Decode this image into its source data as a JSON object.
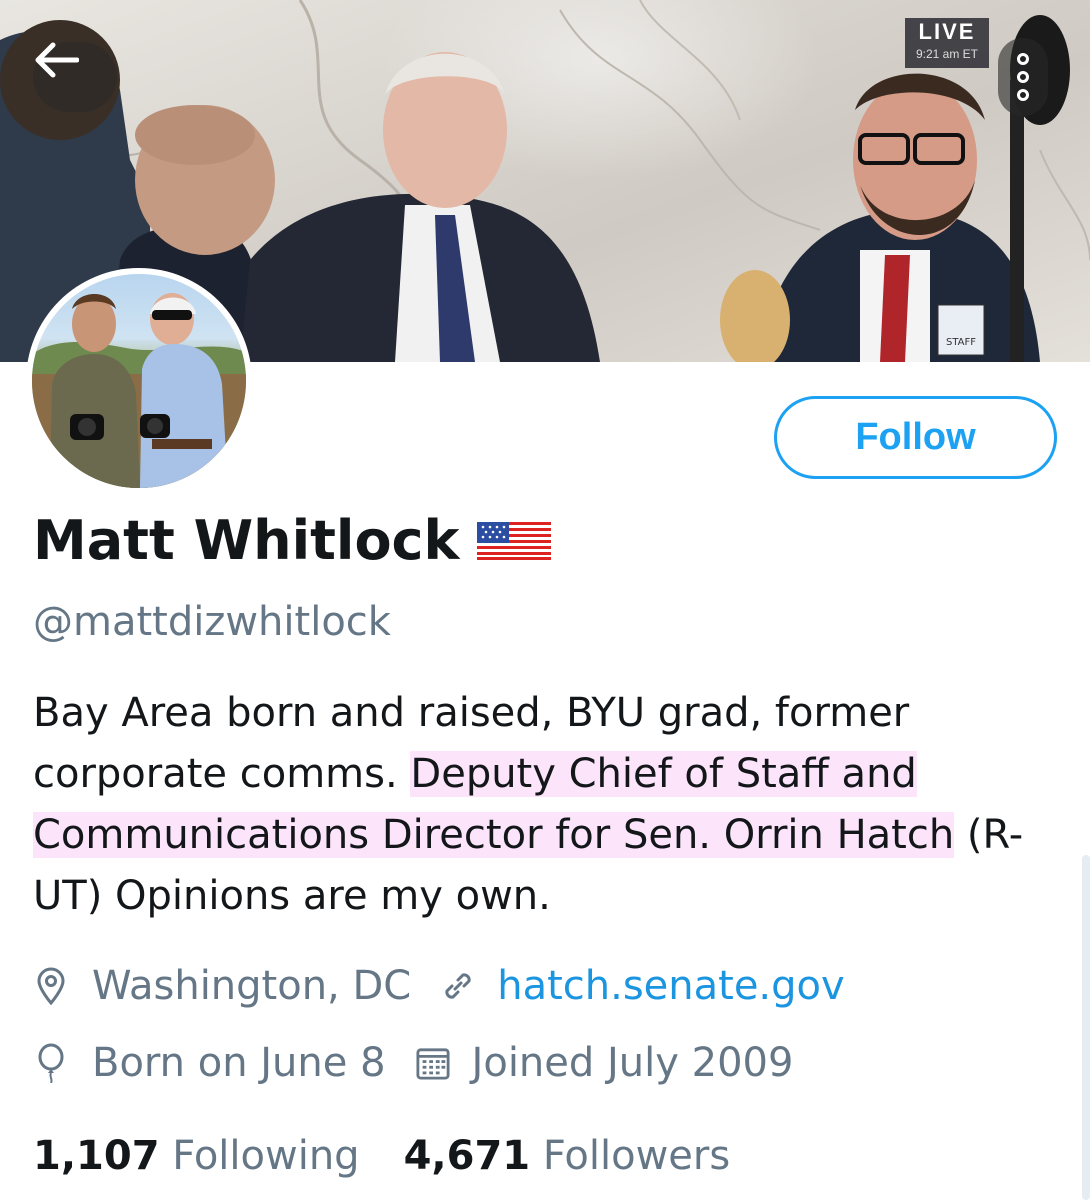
{
  "banner": {
    "live_label": "LIVE",
    "live_time": "9:21 am ET",
    "badge_text": "STAFF"
  },
  "profile": {
    "name": "Matt Whitlock",
    "name_emoji": "us-flag-emoji",
    "handle": "@mattdizwhitlock",
    "bio_part1": "Bay Area born and raised, BYU grad, former corporate comms.",
    "bio_highlight": "Deputy Chief of Staff and Communications Director for Sen. Orrin Hatch",
    "bio_part2": "(R-UT) Opinions are my own.",
    "location": "Washington, DC",
    "website": "hatch.senate.gov",
    "birthday": "Born on June 8",
    "joined": "Joined July 2009"
  },
  "actions": {
    "follow_label": "Follow"
  },
  "stats": {
    "following_count": "1,107",
    "following_label": "Following",
    "followers_count": "4,671",
    "followers_label": "Followers"
  },
  "icons": {
    "back": "arrow-left-icon",
    "more": "more-vertical-icon",
    "location": "location-pin-icon",
    "link": "link-icon",
    "birthday": "balloon-icon",
    "calendar": "calendar-icon"
  },
  "colors": {
    "accent": "#1da1f2",
    "link": "#1b95e0",
    "muted": "#657786",
    "highlight": "#fce4fb"
  }
}
